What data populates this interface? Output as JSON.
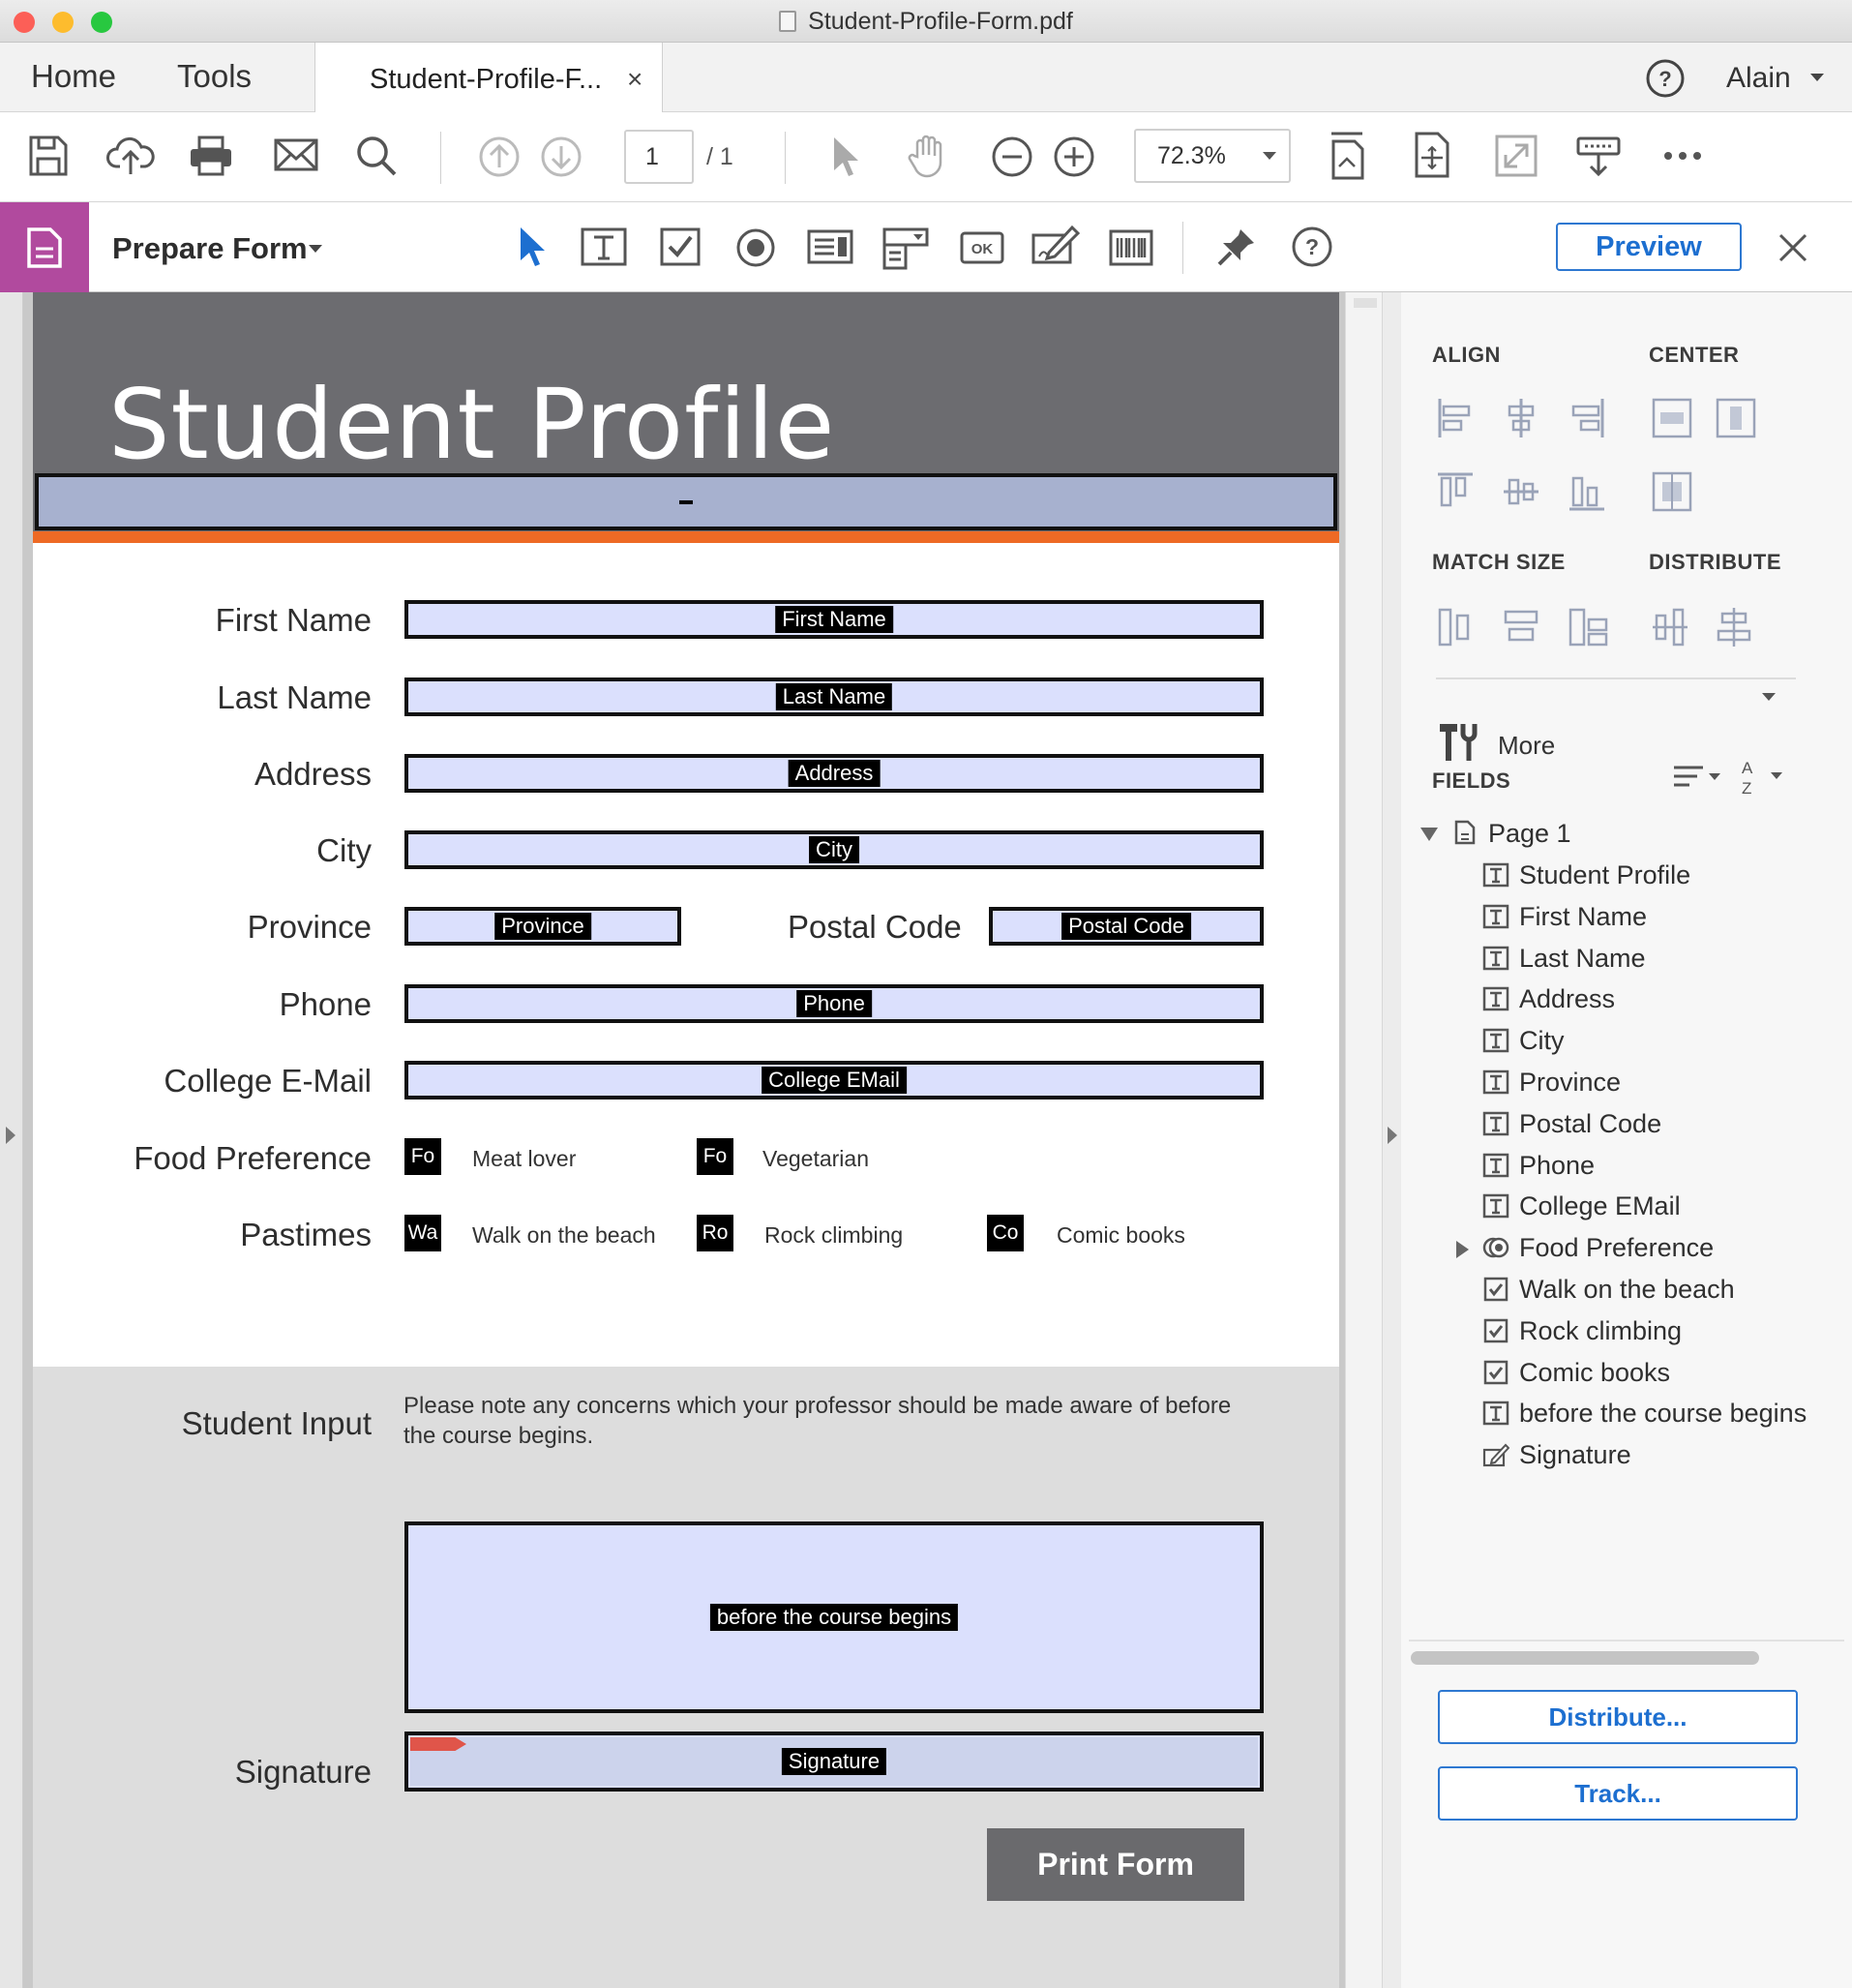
{
  "window": {
    "title": "Student-Profile-Form.pdf"
  },
  "tabbar": {
    "home": "Home",
    "tools": "Tools",
    "doc_tab": "Student-Profile-F...",
    "close": "×",
    "user": "Alain"
  },
  "toolbar": {
    "page_current": "1",
    "page_total": "/ 1",
    "zoom": "72.3%",
    "icons": [
      "save-icon",
      "upload-icon",
      "print-icon",
      "email-icon",
      "search-icon",
      "page-up-icon",
      "page-down-icon",
      "select-arrow-icon",
      "hand-icon",
      "zoom-out-icon",
      "zoom-in-icon",
      "fit-page-icon",
      "rotate-icon",
      "full-screen-icon",
      "read-mode-icon",
      "more-icon"
    ]
  },
  "formbar": {
    "title": "Prepare Form",
    "preview": "Preview",
    "tools": [
      "select-tool-icon",
      "text-field-icon",
      "checkbox-icon",
      "radio-icon",
      "list-box-icon",
      "dropdown-icon",
      "button-icon",
      "signature-icon",
      "barcode-icon",
      "pin-icon",
      "help-icon"
    ]
  },
  "form": {
    "banner_title": "Student Profile",
    "banner_field": "Student Profile",
    "labels": {
      "first_name": "First Name",
      "last_name": "Last Name",
      "address": "Address",
      "city": "City",
      "province": "Province",
      "postal_code": "Postal Code",
      "phone": "Phone",
      "college_email": "College E-Mail",
      "food_preference": "Food Preference",
      "pastimes": "Pastimes",
      "student_input": "Student Input",
      "signature": "Signature"
    },
    "fields": {
      "first_name": "First Name",
      "last_name": "Last Name",
      "address": "Address",
      "city": "City",
      "province": "Province",
      "postal_code": "Postal Code",
      "phone": "Phone",
      "college_email": "College EMail",
      "comments": "before the course begins",
      "signature": "Signature"
    },
    "food_options": [
      {
        "box": "Fo",
        "label": "Meat lover"
      },
      {
        "box": "Fo",
        "label": "Vegetarian"
      }
    ],
    "pastime_options": [
      {
        "box": "Wa",
        "label": "Walk on the beach"
      },
      {
        "box": "Ro",
        "label": "Rock climbing"
      },
      {
        "box": "Co",
        "label": "Comic books"
      }
    ],
    "note": "Please note any concerns which your professor should be made aware of before the course begins.",
    "print_button": "Print Form"
  },
  "panel": {
    "align": "ALIGN",
    "center": "CENTER",
    "match_size": "MATCH SIZE",
    "distribute": "DISTRIBUTE",
    "more": "More",
    "fields_heading": "FIELDS",
    "tree": {
      "page": "Page 1",
      "items": [
        {
          "type": "text",
          "label": "Student Profile"
        },
        {
          "type": "text",
          "label": "First Name"
        },
        {
          "type": "text",
          "label": "Last Name"
        },
        {
          "type": "text",
          "label": "Address"
        },
        {
          "type": "text",
          "label": "City"
        },
        {
          "type": "text",
          "label": "Province"
        },
        {
          "type": "text",
          "label": "Postal Code"
        },
        {
          "type": "text",
          "label": "Phone"
        },
        {
          "type": "text",
          "label": "College EMail"
        },
        {
          "type": "radio",
          "label": "Food Preference"
        },
        {
          "type": "checkbox",
          "label": "Walk on the beach"
        },
        {
          "type": "checkbox",
          "label": "Rock climbing"
        },
        {
          "type": "checkbox",
          "label": "Comic books"
        },
        {
          "type": "text",
          "label": "before the course begins"
        },
        {
          "type": "signature",
          "label": "Signature"
        }
      ]
    },
    "distribute_button": "Distribute...",
    "track_button": "Track..."
  },
  "colors": {
    "accent": "#1d6fd0",
    "prepare_form": "#b14a9e",
    "banner": "#6c6c70",
    "orange": "#ee6a25",
    "field_fill": "#dbe0fd"
  }
}
